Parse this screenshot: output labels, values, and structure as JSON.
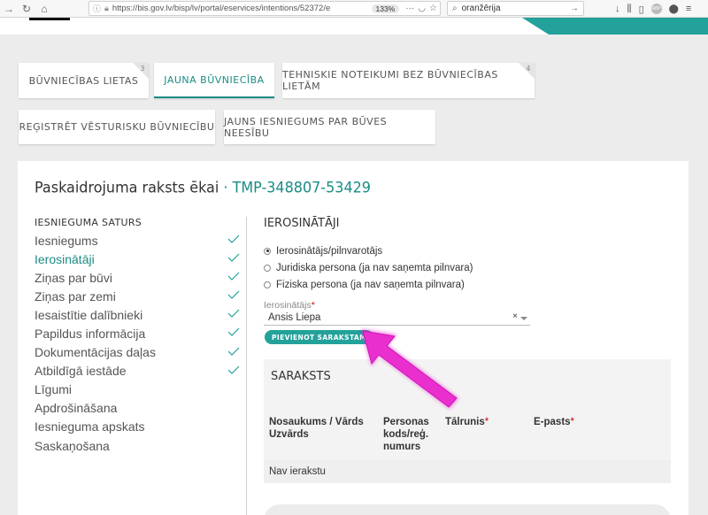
{
  "browser": {
    "url": "https://bis.gov.lv/bisp/lv/portal/eservices/intentions/52372/e",
    "zoom": "133%",
    "search": "oranžērija"
  },
  "tabs": [
    {
      "label": "Būvniecības lietas",
      "count": "3"
    },
    {
      "label": "Jauna būvniecība"
    },
    {
      "label": "Tehniskie noteikumi bez būvniecības lietām",
      "count": "4"
    },
    {
      "label": "Reģistrēt vēsturisku būvniecību"
    },
    {
      "label": "Jauns iesniegums par būves neesību"
    }
  ],
  "page": {
    "title": "Paskaidrojuma raksts ēkai",
    "separator": "·",
    "code": "TMP-348807-53429"
  },
  "sidebar": {
    "heading": "Iesnieguma saturs",
    "items": [
      {
        "label": "Iesniegums",
        "done": true
      },
      {
        "label": "Ierosinātāji",
        "done": true,
        "active": true
      },
      {
        "label": "Ziņas par būvi",
        "done": true
      },
      {
        "label": "Ziņas par zemi",
        "done": true
      },
      {
        "label": "Iesaistītie dalībnieki",
        "done": true
      },
      {
        "label": "Papildus informācija",
        "done": true
      },
      {
        "label": "Dokumentācijas daļas",
        "done": true
      },
      {
        "label": "Atbildīgā iestāde",
        "done": true
      },
      {
        "label": "Līgumi"
      },
      {
        "label": "Apdrošināšana"
      },
      {
        "label": "Iesnieguma apskats"
      },
      {
        "label": "Saskaņošana"
      }
    ]
  },
  "main": {
    "heading": "Ierosinātāji",
    "radios": [
      {
        "label": "Ierosinātājs/pilnvarotājs",
        "checked": true
      },
      {
        "label": "Juridiska persona (ja nav saņemta pilnvara)"
      },
      {
        "label": "Fiziska persona (ja nav saņemta pilnvara)"
      }
    ],
    "field_label": "Ierosinātājs",
    "required_mark": "*",
    "field_value": "Ansis Liepa",
    "clear_glyph": "×",
    "add_button": "Pievienot sarakstam"
  },
  "list": {
    "title": "Saraksts",
    "columns": [
      {
        "label": "Nosaukums / Vārds Uzvārds"
      },
      {
        "label": "Personas kods/reģ. numurs"
      },
      {
        "label": "Tālrunis",
        "required": "*"
      },
      {
        "label": "E-pasts",
        "required": "*"
      }
    ],
    "empty": "Nav ierakstu"
  },
  "colors": {
    "accent": "#22a29a",
    "accent_dark": "#1a8c85",
    "annotation": "#e61ec8"
  }
}
